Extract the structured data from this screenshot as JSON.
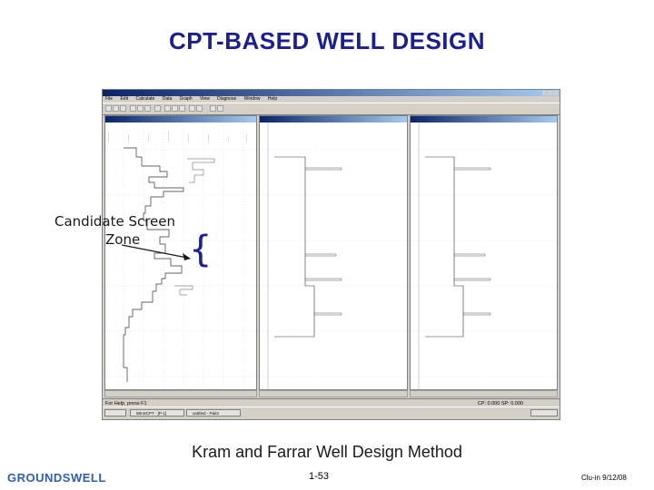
{
  "slide": {
    "title": "CPT-BASED WELL DESIGN",
    "label_line1": "Candidate Screen",
    "label_line2": "Zone",
    "caption": "Kram and Farrar Well Design Method",
    "logo": "GROUNDSWELL",
    "page_number": "1-53",
    "footer_note": "Clu-in 9/12/08"
  },
  "app": {
    "menu": [
      "File",
      "Edit",
      "Calculate",
      "Data",
      "Graph",
      "View",
      "Diagnose",
      "Window",
      "Help"
    ],
    "help_text": "For Help, press F1",
    "readout": "CP: 0.000    SP: 0.000",
    "taskbar": [
      "WinSCPT - [P-1]",
      "untitled - Paint"
    ],
    "colors": {
      "titlebar": "#0a246a",
      "chrome": "#d4d0c8",
      "brace": "#1b1f8f",
      "title_text": "#1b1f8f"
    }
  }
}
